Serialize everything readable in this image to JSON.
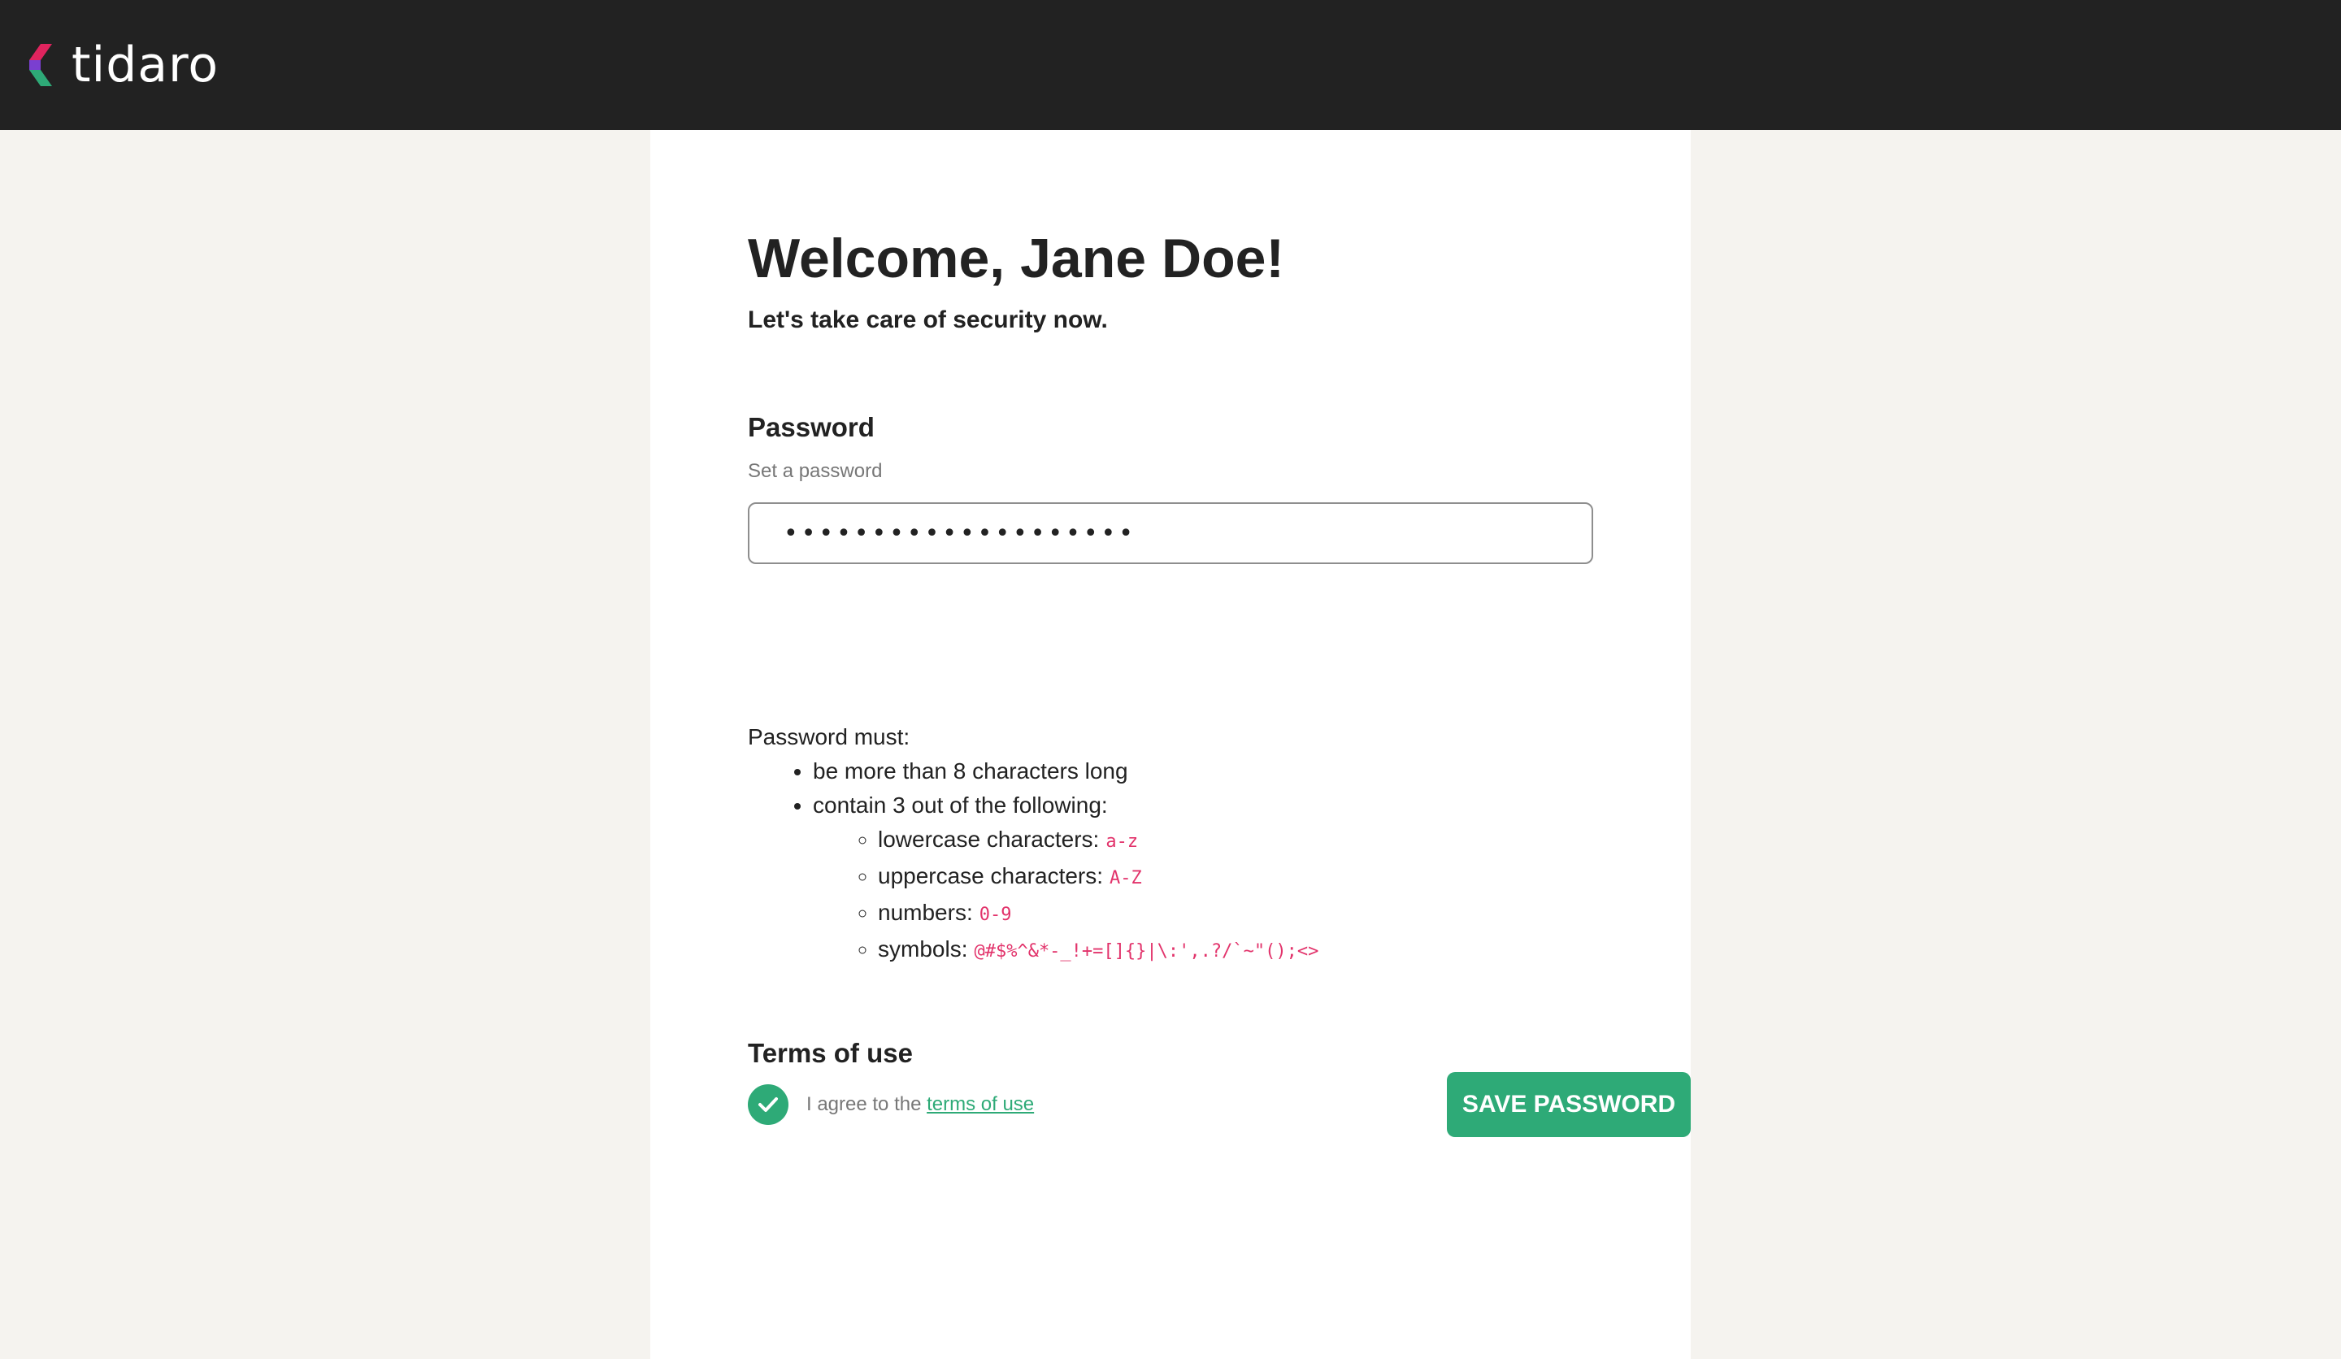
{
  "brand": {
    "name": "tidaro",
    "colors": {
      "accent": "#2eaa77",
      "code": "#e2336b",
      "header_bg": "#222222"
    }
  },
  "welcome": {
    "heading": "Welcome, Jane Doe!",
    "subtitle": "Let's take care of security now."
  },
  "password": {
    "label": "Password",
    "help": "Set a password",
    "value": "••••••••••••••••••••",
    "rules_intro": "Password must:",
    "rule_length": "be more than 8 characters long",
    "rule_contain": "contain 3 out of the following:",
    "classes": [
      {
        "label": "lowercase characters:",
        "example": "a-z"
      },
      {
        "label": "uppercase characters:",
        "example": "A-Z"
      },
      {
        "label": "numbers:",
        "example": "0-9"
      },
      {
        "label": "symbols:",
        "example": "@#$%^&*-_!+=[]{}|\\:',.?/`~\"();<>"
      }
    ]
  },
  "terms": {
    "label": "Terms of use",
    "agree_prefix": "I agree to the",
    "link_text": "terms of use",
    "checked": true
  },
  "actions": {
    "save_label": "SAVE PASSWORD"
  }
}
